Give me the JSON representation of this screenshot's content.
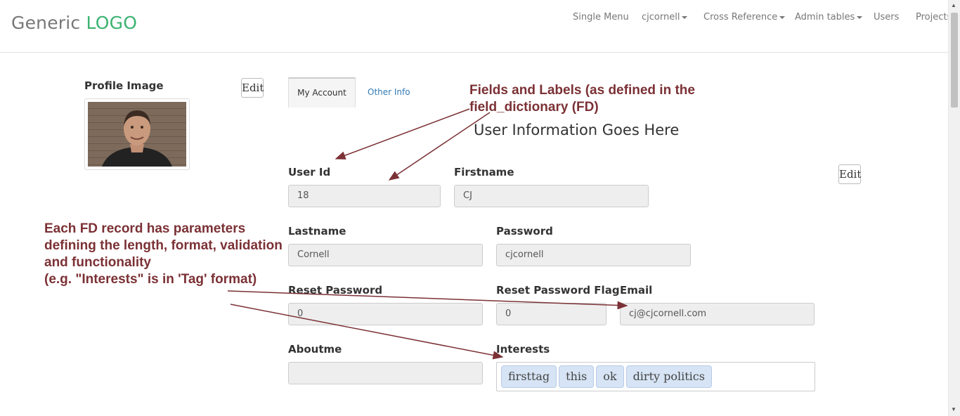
{
  "navbar": {
    "brand_prefix": "Generic",
    "brand_accent": "LOGO",
    "items": [
      {
        "label": "Single Menu",
        "dropdown": false
      },
      {
        "label": "cjcornell",
        "dropdown": true
      },
      {
        "label": "Cross Reference",
        "dropdown": true
      },
      {
        "label": "Admin tables",
        "dropdown": true
      },
      {
        "label": "Users",
        "dropdown": false
      },
      {
        "label": "Projects",
        "dropdown": false
      }
    ]
  },
  "profile": {
    "title": "Profile Image",
    "edit_label": "Edit"
  },
  "tabs": [
    {
      "label": "My Account",
      "active": true
    },
    {
      "label": "Other Info",
      "active": false
    }
  ],
  "form": {
    "heading": "User Information Goes Here",
    "edit_label": "Edit",
    "fields": {
      "user_id": {
        "label": "User Id",
        "value": "18"
      },
      "firstname": {
        "label": "Firstname",
        "value": "CJ"
      },
      "lastname": {
        "label": "Lastname",
        "value": "Cornell"
      },
      "password": {
        "label": "Password",
        "value": "cjcornell"
      },
      "reset_password": {
        "label": "Reset Password",
        "value": "0"
      },
      "reset_password_flag": {
        "label": "Reset Password Flag",
        "value": "0"
      },
      "email": {
        "label": "Email",
        "value": "cj@cjcornell.com"
      },
      "aboutme": {
        "label": "Aboutme",
        "value": ""
      },
      "interests": {
        "label": "Interests",
        "tags": [
          "firsttag",
          "this",
          "ok",
          "dirty politics"
        ]
      }
    }
  },
  "annotations": {
    "fields_note_line1": "Fields and Labels (as defined in the",
    "fields_note_line2": "field_dictionary (FD)",
    "fd_note_line1": "Each FD record has parameters",
    "fd_note_line2": "defining the length, format, validation",
    "fd_note_line3": "and functionality",
    "fd_note_line4": "(e.g. \"Interests\" is in 'Tag' format)"
  },
  "colors": {
    "brand_accent": "#3cb371",
    "annotation": "#7b3135",
    "tab_link": "#337ab7",
    "tag_bg": "#d6e4f5"
  }
}
